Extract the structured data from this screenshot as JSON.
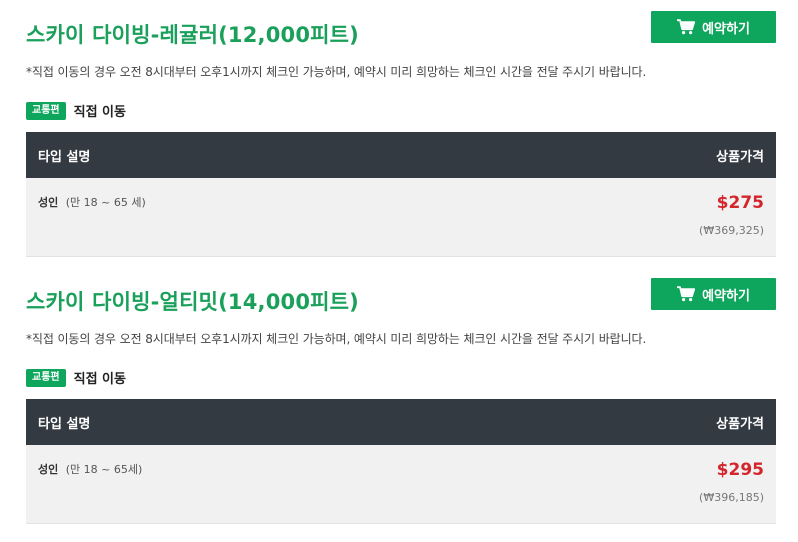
{
  "reserve_label": "예약하기",
  "icons": {
    "cart": "cart-icon"
  },
  "colors": {
    "title_green": "#1aa05a",
    "button_green": "#0ea55c",
    "table_header": "#333a42",
    "price_red": "#d3252c"
  },
  "products": [
    {
      "title": "스카이 다이빙-레귤러(12,000피트)",
      "notice": "*직접 이동의 경우 오전 8시대부터 오후1시까지 체크인 가능하며, 예약시 미리 희망하는 체크인 시간을 전달 주시기 바랍니다.",
      "transport_badge": "교통편",
      "transport_value": "직접 이동",
      "table_header": {
        "type": "타입 설명",
        "price": "상품가격"
      },
      "rows": [
        {
          "type": "성인",
          "range": "(만 18 ~ 65 세)",
          "price_usd": "$275",
          "price_krw": "(₩369,325)"
        }
      ]
    },
    {
      "title": "스카이 다이빙-얼티밋(14,000피트)",
      "notice": "*직접 이동의 경우 오전 8시대부터 오후1시까지 체크인 가능하며, 예약시 미리 희망하는 체크인 시간을 전달 주시기 바랍니다.",
      "transport_badge": "교통편",
      "transport_value": "직접 이동",
      "table_header": {
        "type": "타입 설명",
        "price": "상품가격"
      },
      "rows": [
        {
          "type": "성인",
          "range": "(만 18 ~ 65세)",
          "price_usd": "$295",
          "price_krw": "(₩396,185)"
        }
      ]
    }
  ]
}
